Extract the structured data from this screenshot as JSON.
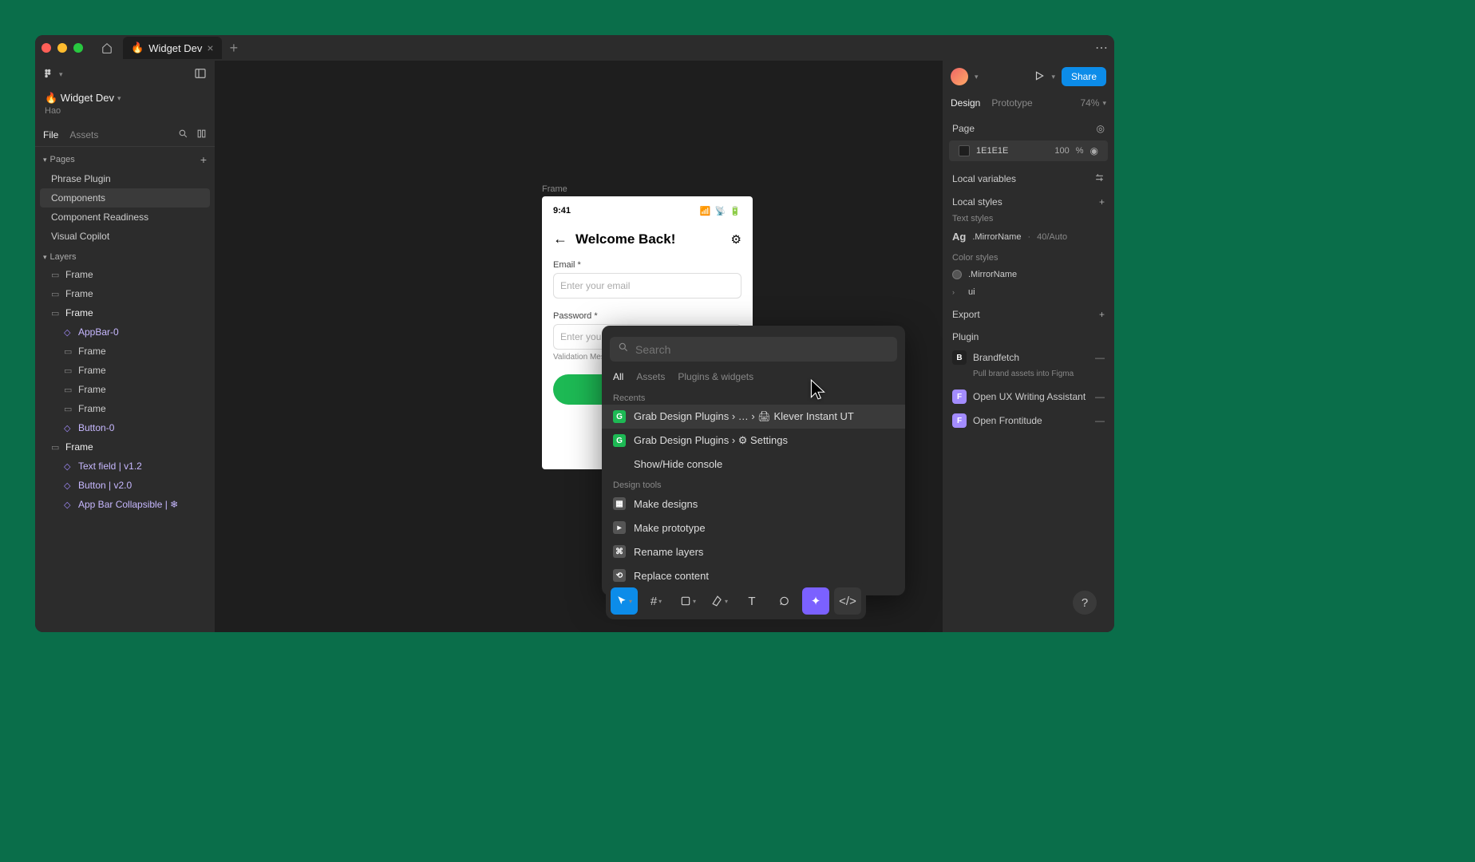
{
  "titlebar": {
    "tab_title": "Widget Dev",
    "tab_emoji": "🔥"
  },
  "left_panel": {
    "project_name": "🔥 Widget Dev",
    "owner": "Hao",
    "tabs": {
      "file": "File",
      "assets": "Assets"
    },
    "pages_header": "Pages",
    "pages": [
      {
        "label": "Phrase Plugin"
      },
      {
        "label": "Components",
        "active": true
      },
      {
        "label": "Component Readiness"
      },
      {
        "label": "Visual Copilot"
      }
    ],
    "layers_header": "Layers",
    "layers": [
      {
        "label": "Frame",
        "type": "frame",
        "indent": 0
      },
      {
        "label": "Frame",
        "type": "frame",
        "indent": 0
      },
      {
        "label": "Frame",
        "type": "frame",
        "indent": 0,
        "bold": true
      },
      {
        "label": "AppBar-0",
        "type": "comp",
        "indent": 1
      },
      {
        "label": "Frame",
        "type": "frame",
        "indent": 1
      },
      {
        "label": "Frame",
        "type": "frame",
        "indent": 1
      },
      {
        "label": "Frame",
        "type": "frame",
        "indent": 1
      },
      {
        "label": "Frame",
        "type": "frame",
        "indent": 1
      },
      {
        "label": "Button-0",
        "type": "comp",
        "indent": 1
      },
      {
        "label": "Frame",
        "type": "frame",
        "indent": 0,
        "bold": true
      },
      {
        "label": "Text field | v1.2",
        "type": "comp",
        "indent": 1
      },
      {
        "label": "Button | v2.0",
        "type": "comp",
        "indent": 1
      },
      {
        "label": "App Bar Collapsible | ❄",
        "type": "comp",
        "indent": 1
      }
    ]
  },
  "canvas": {
    "frame_label": "Frame",
    "mock": {
      "time": "9:41",
      "title": "Welcome Back!",
      "email_label": "Email *",
      "email_placeholder": "Enter your email",
      "password_label": "Password *",
      "password_placeholder": "Enter your p",
      "validation": "Validation Mess"
    }
  },
  "quick_actions": {
    "search_placeholder": "Search",
    "tabs": {
      "all": "All",
      "assets": "Assets",
      "plugins": "Plugins & widgets"
    },
    "recents_header": "Recents",
    "recents": [
      {
        "label": "Grab Design Plugins › … › 🖨 Klever Instant UT",
        "hover": true
      },
      {
        "label": "Grab Design Plugins › ⚙ Settings"
      },
      {
        "label": "Show/Hide console",
        "plain": true
      }
    ],
    "design_tools_header": "Design tools",
    "design_tools": [
      {
        "label": "Make designs"
      },
      {
        "label": "Make prototype"
      },
      {
        "label": "Rename layers"
      },
      {
        "label": "Replace content"
      }
    ]
  },
  "right_panel": {
    "tabs": {
      "design": "Design",
      "prototype": "Prototype"
    },
    "zoom": "74%",
    "share": "Share",
    "page_header": "Page",
    "page_color": "1E1E1E",
    "page_opacity": "100",
    "page_opacity_unit": "%",
    "local_variables": "Local variables",
    "local_styles": "Local styles",
    "text_styles": "Text styles",
    "text_style_name": ".MirrorName",
    "text_style_meta": "40/Auto",
    "color_styles": "Color styles",
    "color_style_name": ".MirrorName",
    "color_group": "ui",
    "export": "Export",
    "plugin_header": "Plugin",
    "plugins": [
      {
        "name": "Brandfetch",
        "desc": "Pull brand assets into Figma",
        "bg": "#222",
        "letter": "B"
      },
      {
        "name": "Open UX Writing Assistant",
        "bg": "#a38cff",
        "letter": "F"
      },
      {
        "name": "Open Frontitude",
        "bg": "#a38cff",
        "letter": "F"
      }
    ]
  }
}
